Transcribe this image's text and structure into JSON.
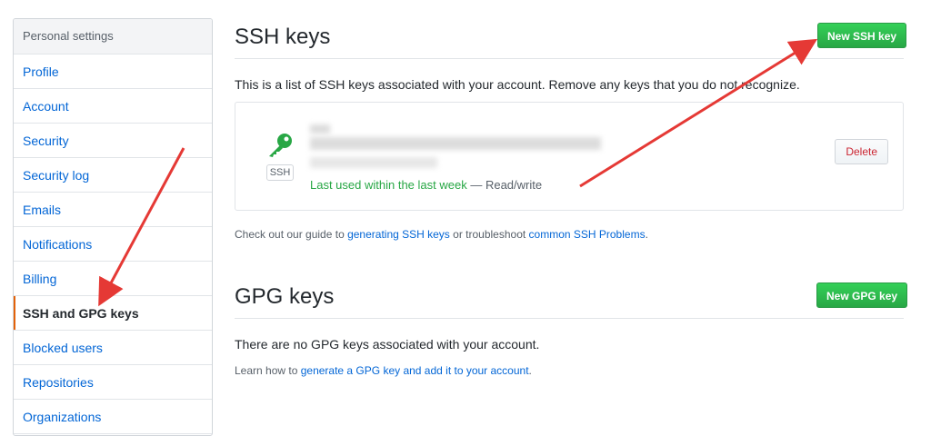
{
  "sidebar": {
    "header": "Personal settings",
    "items": [
      {
        "label": "Profile"
      },
      {
        "label": "Account"
      },
      {
        "label": "Security"
      },
      {
        "label": "Security log"
      },
      {
        "label": "Emails"
      },
      {
        "label": "Notifications"
      },
      {
        "label": "Billing"
      },
      {
        "label": "SSH and GPG keys",
        "selected": true
      },
      {
        "label": "Blocked users"
      },
      {
        "label": "Repositories"
      },
      {
        "label": "Organizations"
      }
    ]
  },
  "ssh": {
    "title": "SSH keys",
    "new_button": "New SSH key",
    "description": "This is a list of SSH keys associated with your account. Remove any keys that you do not recognize.",
    "key": {
      "badge": "SSH",
      "last_used": "Last used within the last week",
      "separator": " — ",
      "access": "Read/write",
      "delete_label": "Delete"
    },
    "help": {
      "prefix": "Check out our guide to ",
      "link1": "generating SSH keys",
      "middle": " or troubleshoot ",
      "link2": "common SSH Problems",
      "suffix": "."
    }
  },
  "gpg": {
    "title": "GPG keys",
    "new_button": "New GPG key",
    "empty": "There are no GPG keys associated with your account.",
    "help": {
      "prefix": "Learn how to ",
      "link": "generate a GPG key and add it to your account",
      "suffix": "."
    }
  },
  "colors": {
    "accent": "#0366d6",
    "primary_green": "#28a745",
    "danger": "#cb2431",
    "selected_marker": "#e36209",
    "arrow": "#e53935"
  }
}
